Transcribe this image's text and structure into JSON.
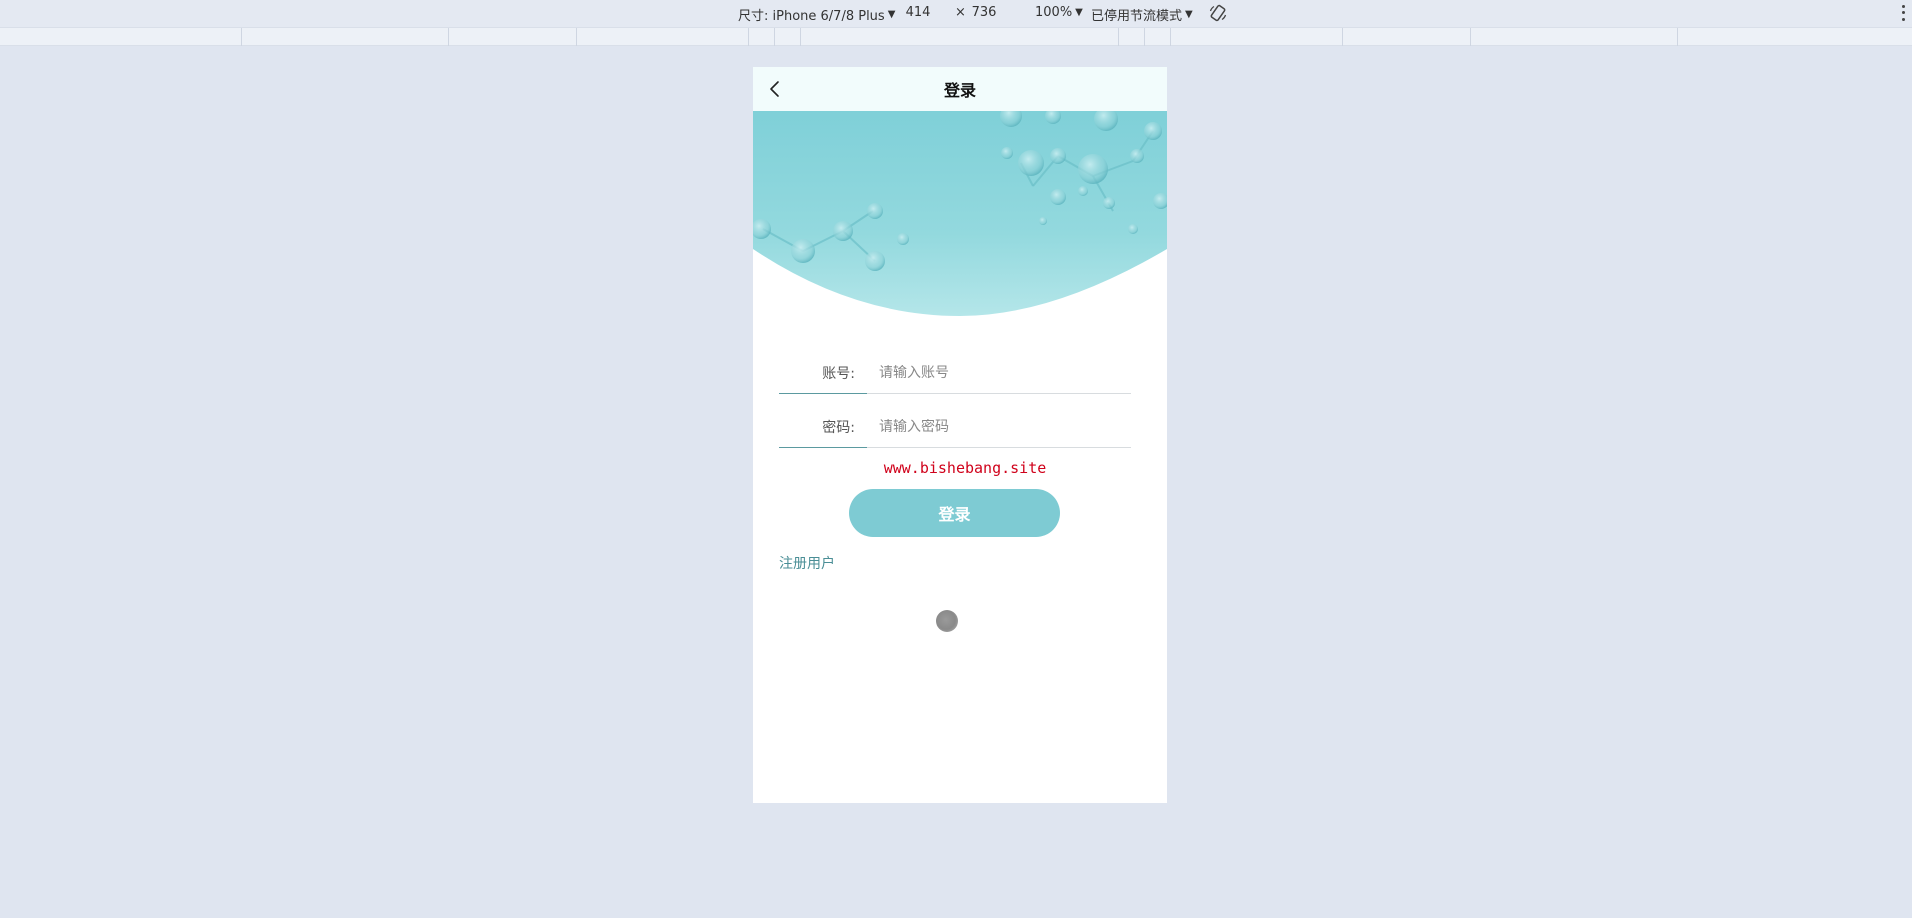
{
  "devtools": {
    "device_label": "尺寸: iPhone 6/7/8 Plus",
    "width_value": "414",
    "times_sign": "×",
    "height_value": "736",
    "zoom_label": "100%",
    "throttle_label": "已停用节流模式",
    "colors": {
      "toolbar_bg": "#e4e9f2",
      "page_bg": "#dfe5f0"
    }
  },
  "page": {
    "nav": {
      "title": "登录",
      "back_icon": "chevron-left-icon"
    },
    "form": {
      "account": {
        "label": "账号:",
        "placeholder": "请输入账号",
        "value": ""
      },
      "password": {
        "label": "密码:",
        "placeholder": "请输入密码",
        "value": ""
      }
    },
    "watermark": "www.bishebang.site",
    "login_button": "登录",
    "register_link": "注册用户",
    "colors": {
      "accent": "#7ecbd3",
      "link": "#4a8e96",
      "watermark": "#d0021b",
      "nav_bg": "#f2fcfc"
    }
  }
}
